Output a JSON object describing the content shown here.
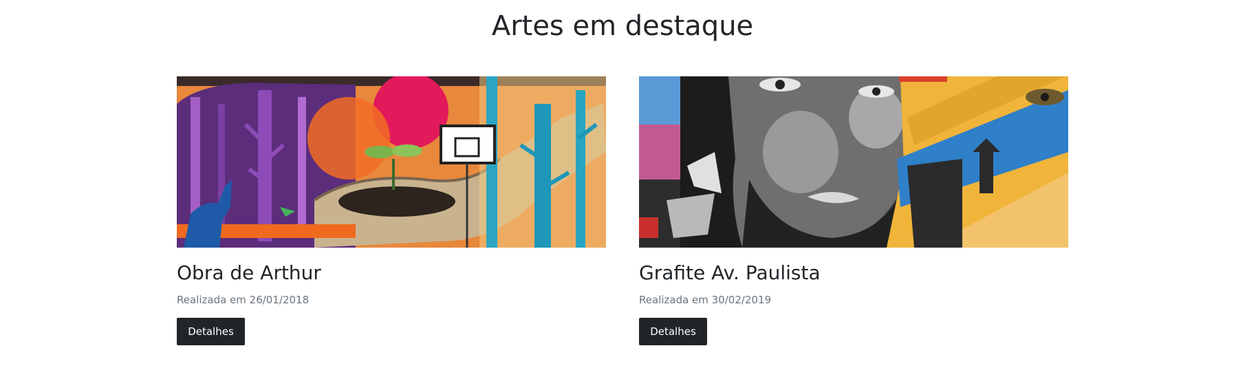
{
  "section": {
    "title": "Artes em destaque"
  },
  "cards": [
    {
      "image_alt": "Obra de Arthur",
      "title": "Obra de Arthur",
      "date": "Realizada em 26/01/2018",
      "button_label": "Detalhes"
    },
    {
      "image_alt": "Grafite Av. Paulista",
      "title": "Grafite Av. Paulista",
      "date": "Realizada em 30/02/2019",
      "button_label": "Detalhes"
    }
  ],
  "colors": {
    "text": "#212529",
    "muted": "#6c757d",
    "button_bg": "#212529",
    "button_text": "#ffffff"
  }
}
